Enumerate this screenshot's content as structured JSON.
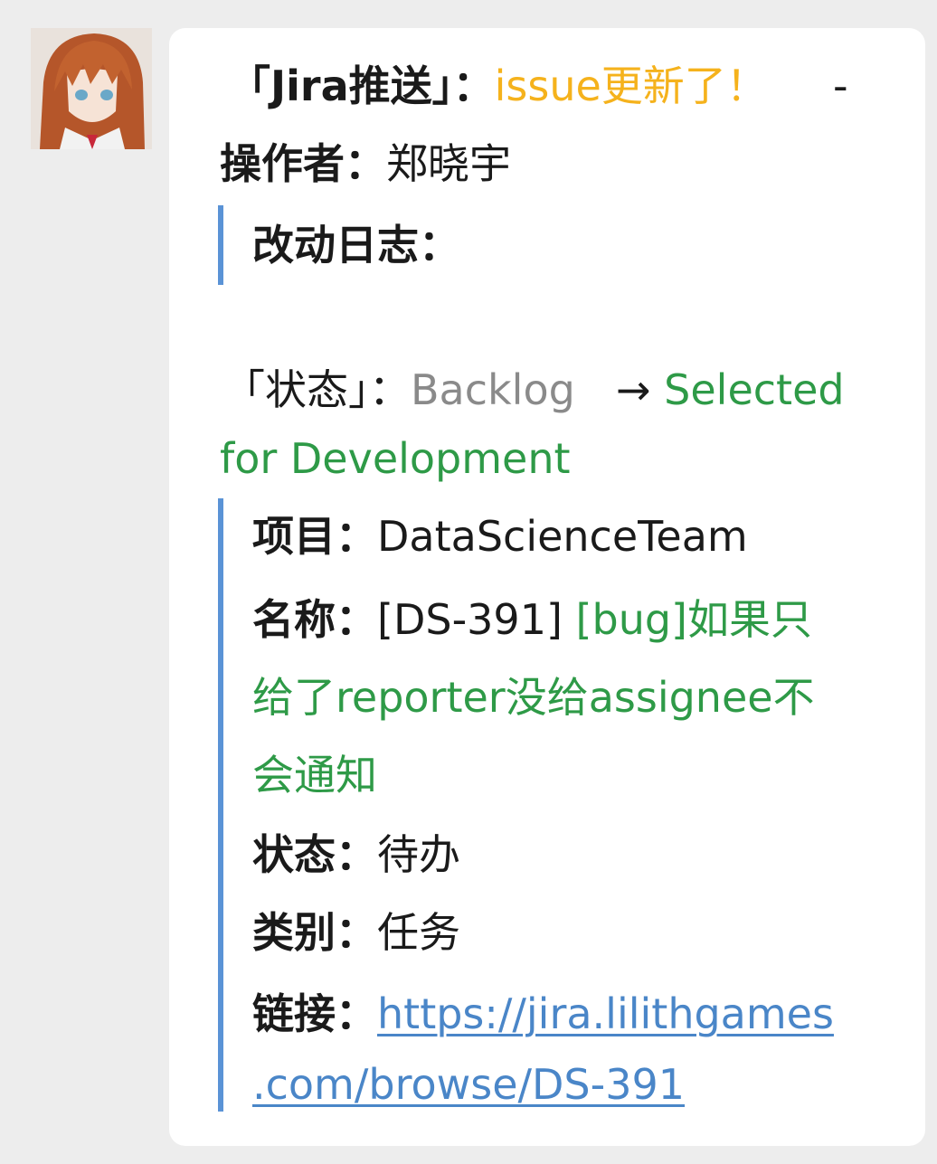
{
  "message": {
    "header": {
      "source": "「Jira推送」：",
      "event": "issue更新了！",
      "dash": "-"
    },
    "operator": {
      "label": "操作者：",
      "value": "郑晓宇"
    },
    "changelog": {
      "label": "改动日志：",
      "field": "「状态」：",
      "from": "Backlog",
      "arrow": "→",
      "to_line1": "Selected",
      "to_line2": "for Development"
    },
    "issue": {
      "project_label": "项目：",
      "project_value": "DataScienceTeam",
      "name_label": "名称：",
      "name_key": "[DS-391]",
      "name_title_line1": "[bug]如果只",
      "name_title_line2": "给了reporter没给assignee不",
      "name_title_line3": "会通知",
      "status_label": "状态：",
      "status_value": "待办",
      "type_label": "类别：",
      "type_value": "任务",
      "link_label": "链接：",
      "link_line1": "https://jira.lilithgames",
      "link_line2": ".com/browse/DS-391"
    }
  },
  "colors": {
    "accent_yellow": "#f5b21c",
    "status_green": "#2e9a47",
    "muted_gray": "#8a8a8a",
    "link_blue": "#4a86c8",
    "quote_bar": "#5a93d6"
  },
  "icons": {
    "avatar": "anime-character-avatar"
  }
}
